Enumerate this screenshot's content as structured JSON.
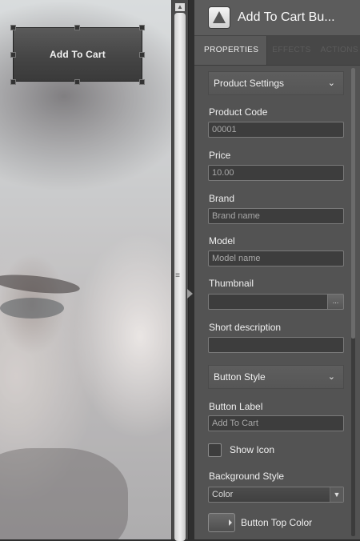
{
  "canvas": {
    "button_label": "Add To Cart"
  },
  "panel": {
    "title": "Add To Cart Bu...",
    "icon": "triangle-logo-icon",
    "tabs": [
      {
        "label": "PROPERTIES",
        "active": true
      },
      {
        "label": "EFFECTS",
        "active": false
      },
      {
        "label": "ACTIONS",
        "active": false
      }
    ],
    "product_settings": {
      "section_label": "Product Settings",
      "product_code": {
        "label": "Product Code",
        "value": "00001"
      },
      "price": {
        "label": "Price",
        "value": "10.00"
      },
      "brand": {
        "label": "Brand",
        "placeholder": "Brand name"
      },
      "model": {
        "label": "Model",
        "placeholder": "Model name"
      },
      "thumbnail": {
        "label": "Thumbnail",
        "value": "",
        "browse_label": "..."
      },
      "short_description": {
        "label": "Short description",
        "value": ""
      }
    },
    "button_style": {
      "section_label": "Button Style",
      "button_label": {
        "label": "Button Label",
        "placeholder": "Add To Cart"
      },
      "show_icon": {
        "label": "Show Icon",
        "checked": false
      },
      "background_style": {
        "label": "Background Style",
        "selected": "Color"
      },
      "button_top_color": {
        "label": "Button Top Color"
      }
    }
  },
  "colors": {
    "panel_bg": "#535353",
    "field_bg": "#3d3d3d",
    "text": "#f0f0f0"
  }
}
